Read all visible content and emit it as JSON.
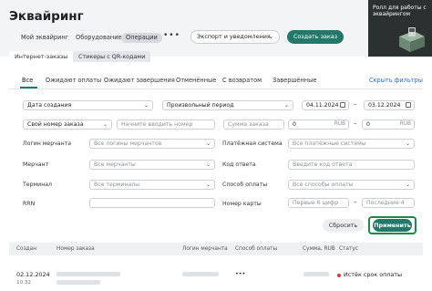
{
  "header": {
    "title": "Эквайринг",
    "tabs": [
      {
        "label": "Мой эквайринг",
        "active": false
      },
      {
        "label": "Оборудование",
        "active": false
      },
      {
        "label": "Операции",
        "active": true
      }
    ],
    "more_icon": "more-horizontal-icon",
    "export_label": "Экспорт и уведомления",
    "create_label": "Создать заказ"
  },
  "promo": {
    "text": "Ролл для работы с эквайрингом",
    "icon": "terminal-box-illustration"
  },
  "subtabs": [
    {
      "label": "Интернет-заказы",
      "active": true
    },
    {
      "label": "Стикеры с QR-кодами",
      "active": false
    }
  ],
  "status_tabs": {
    "items": [
      "Все",
      "Ожидают оплаты",
      "Ожидают завершения",
      "Отменённые",
      "С возвратом",
      "Завершённые"
    ],
    "active_index": 0,
    "hide_filters": "Скрыть фильтры"
  },
  "filters": {
    "date_type": "Дата создания",
    "period": "Произвольный период",
    "date_from": "04.11.2024",
    "date_to": "03.12.2024",
    "order_number_type": "Свой номер заказа",
    "order_number_placeholder": "Начните вводить номер",
    "amount_placeholder": "Сумма заказа",
    "amount_from": "0",
    "amount_to": "0",
    "currency": "RUB",
    "merchant_login_label": "Логин мерчанта",
    "merchant_login_value": "Все логины мерчантов",
    "payment_system_label": "Платёжная система",
    "payment_system_value": "Все платёжные системы",
    "merchant_label": "Мерчант",
    "merchant_value": "Все мерчанты",
    "response_code_label": "Код ответа",
    "response_code_placeholder": "Введите код ответа",
    "terminal_label": "Терминал",
    "terminal_value": "Все терминалы",
    "payment_method_label": "Способ оплаты",
    "payment_method_value": "Все способы оплаты",
    "rrn_label": "RRN",
    "card_number_label": "Номер карты",
    "card_first_placeholder": "Первые 6 цифр",
    "card_last_placeholder": "Последние 4",
    "reset_label": "Сбросить",
    "apply_label": "Применить"
  },
  "table": {
    "headers": [
      "Создан",
      "Номер заказа",
      "Логин мерчанта",
      "Способ оплаты",
      "Сумма, RUB",
      "Статус"
    ],
    "rows": [
      {
        "date": "02.12.2024",
        "time": "10:32",
        "payment": "•••",
        "status": "Истёк срок оплаты"
      }
    ]
  },
  "colors": {
    "accent": "#22796a",
    "highlight_border": "#1e8a4a",
    "link": "#2f6fd6",
    "status_error": "#d33b3b"
  }
}
